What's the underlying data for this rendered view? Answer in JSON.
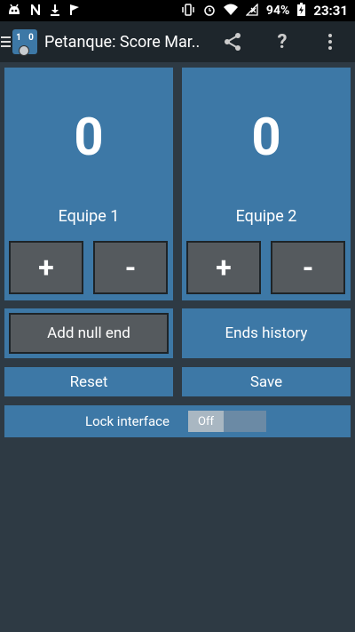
{
  "status_bar": {
    "battery": "94%",
    "time": "23:31"
  },
  "toolbar": {
    "app_icon_left": "1",
    "app_icon_right": "0",
    "title": "Petanque: Score Mar..."
  },
  "teams": [
    {
      "score": "0",
      "name": "Equipe 1",
      "plus_label": "+",
      "minus_label": "-"
    },
    {
      "score": "0",
      "name": "Equipe 2",
      "plus_label": "+",
      "minus_label": "-"
    }
  ],
  "actions": {
    "add_null_end": "Add null end",
    "ends_history": "Ends history",
    "reset": "Reset",
    "save": "Save"
  },
  "lock": {
    "label": "Lock interface",
    "toggle_state": "Off"
  },
  "colors": {
    "background": "#2e3a44",
    "panel": "#3d78a6",
    "button": "#555a5e",
    "toolbar": "#1e262c"
  },
  "icons": {
    "status_left": [
      "android-robot-icon",
      "n-notification-icon",
      "download-icon",
      "flag-icon"
    ],
    "status_right": [
      "vibrate-icon",
      "alarm-icon",
      "wifi-icon",
      "no-signal-icon",
      "battery-icon"
    ],
    "toolbar": [
      "menu-icon",
      "app-logo-icon",
      "share-icon",
      "help-icon",
      "overflow-menu-icon"
    ]
  }
}
